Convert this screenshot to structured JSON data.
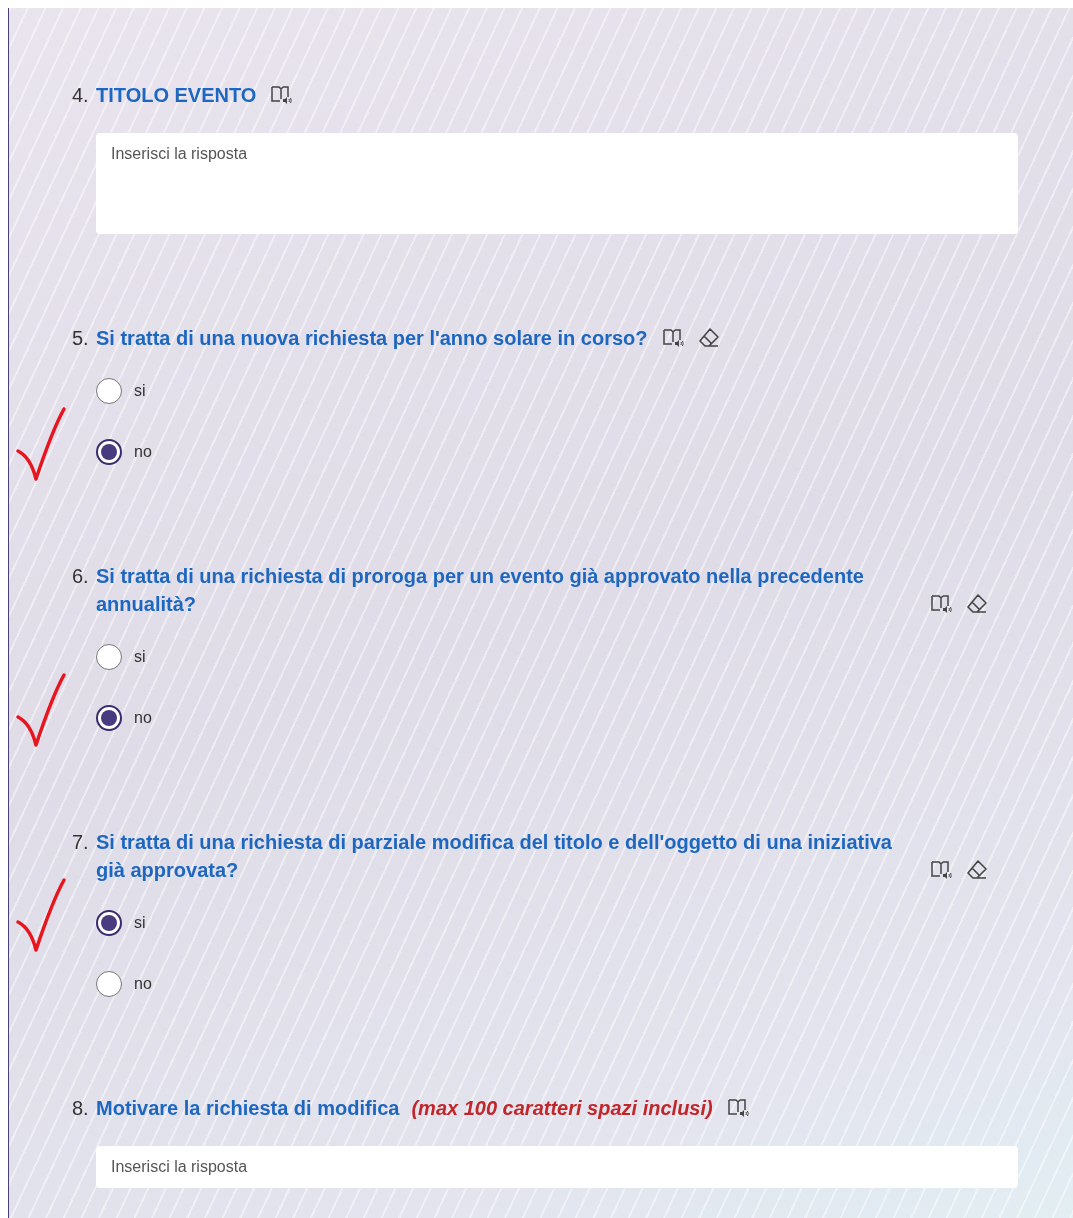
{
  "questions": [
    {
      "number": "4.",
      "title": "TITOLO EVENTO",
      "kind": "long_text",
      "placeholder": "Inserisci la risposta"
    },
    {
      "number": "5.",
      "title": "Si tratta di una nuova richiesta per l'anno solare in corso?",
      "kind": "choice",
      "options": [
        {
          "label": "si",
          "selected": false,
          "hand_check": false
        },
        {
          "label": "no",
          "selected": true,
          "hand_check": true
        }
      ]
    },
    {
      "number": "6.",
      "title": "Si tratta di una richiesta di proroga per un evento già approvato nella precedente annualità?",
      "kind": "choice",
      "options": [
        {
          "label": "si",
          "selected": false,
          "hand_check": false
        },
        {
          "label": "no",
          "selected": true,
          "hand_check": true
        }
      ]
    },
    {
      "number": "7.",
      "title": "Si tratta di una richiesta di parziale modifica del titolo e dell'oggetto di una iniziativa già approvata?",
      "kind": "choice",
      "options": [
        {
          "label": "si",
          "selected": true,
          "hand_check": true
        },
        {
          "label": "no",
          "selected": false,
          "hand_check": false
        }
      ]
    },
    {
      "number": "8.",
      "title": "Motivare la richiesta di modifica",
      "note": "(max 100 caratteri spazi inclusi)",
      "kind": "text",
      "placeholder": "Inserisci la risposta"
    }
  ]
}
